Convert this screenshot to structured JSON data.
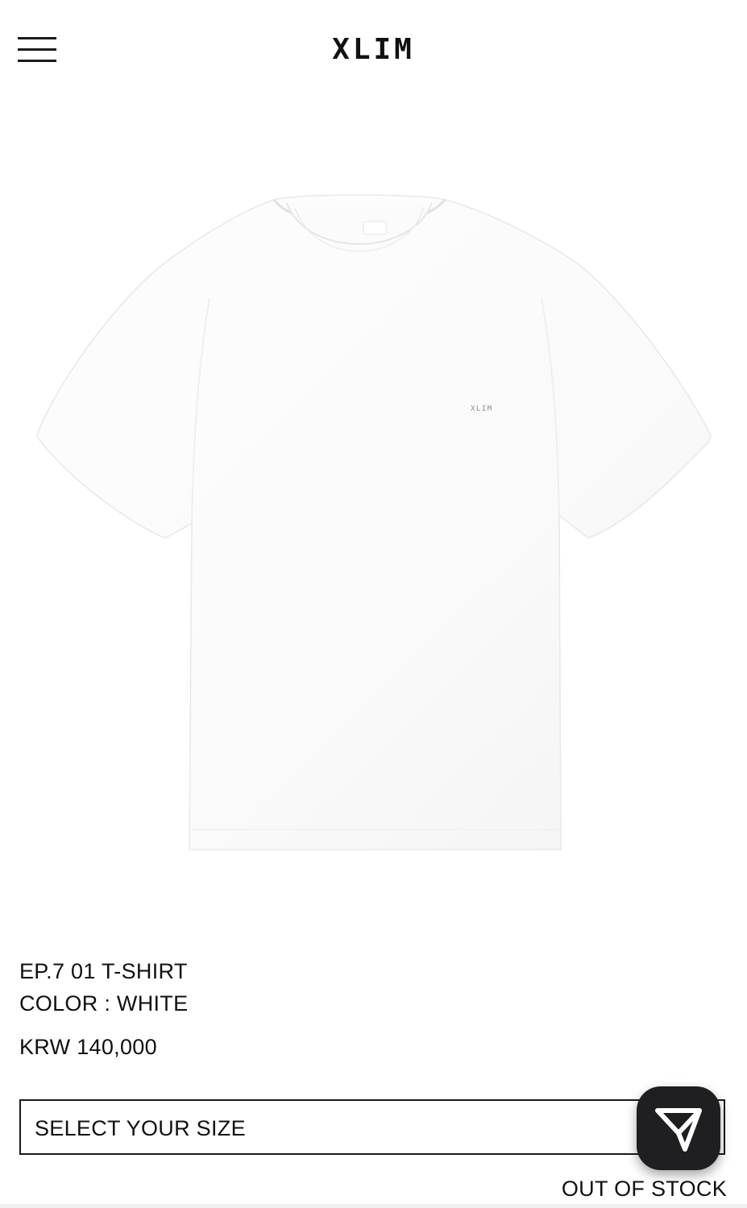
{
  "header": {
    "brand": "XLIM",
    "menu_icon": "hamburger-menu-icon"
  },
  "product": {
    "image_logo_text": "XLIM",
    "image_alt": "EP.7 01 T-SHIRT",
    "name": "EP.7 01 T-SHIRT",
    "color": "COLOR : WHITE",
    "price": "KRW 140,000"
  },
  "size_select": {
    "label": "SELECT YOUR SIZE"
  },
  "share_button": {
    "icon": "paper-plane-icon",
    "color": "#1f1f21"
  },
  "stock_status": "OUT OF STOCK"
}
